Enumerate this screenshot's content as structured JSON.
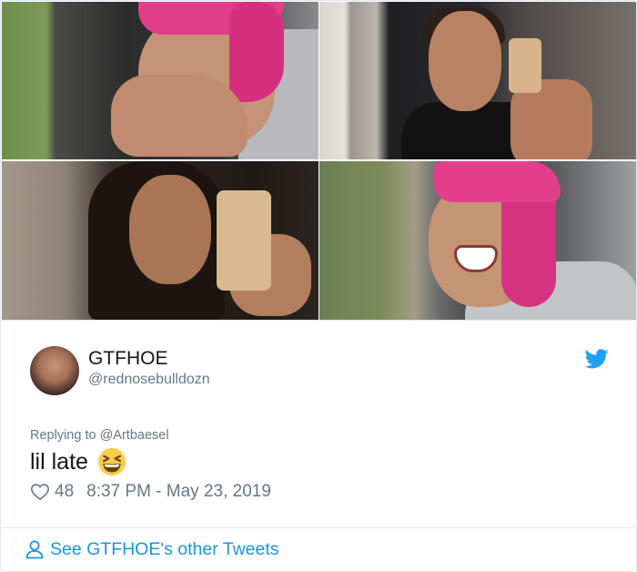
{
  "photos": [
    {
      "alt": "photo-1"
    },
    {
      "alt": "photo-2"
    },
    {
      "alt": "photo-3"
    },
    {
      "alt": "photo-4"
    }
  ],
  "author": {
    "display_name": "GTFHOE",
    "handle": "@rednosebulldozn"
  },
  "tweet": {
    "reply_prefix": "Replying to",
    "reply_to": "@Artbaesel",
    "text": "lil late",
    "emoji": "grinning-squinting-face-emoji"
  },
  "meta": {
    "likes": "48",
    "timestamp": "8:37 PM - May 23, 2019"
  },
  "footer": {
    "other_tweets_label": "See GTFHOE's other Tweets"
  },
  "colors": {
    "link": "#1b95e0",
    "muted": "#657786",
    "text": "#14171a",
    "twitter_blue": "#1da1f2"
  },
  "icons": [
    "twitter-bird-icon",
    "heart-icon",
    "person-icon"
  ]
}
